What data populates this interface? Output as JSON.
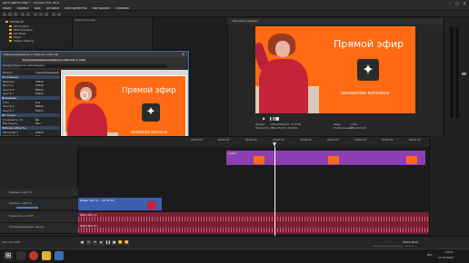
{
  "window": {
    "title": "ДЛЯ ДВНЯ.veg * - VEGAS Pro 16.0",
    "colors": {
      "accent": "#3c6db0",
      "preview_bg": "#ff6a12",
      "clip_purple": "#8b3fb0",
      "audio_red": "#7a1f34",
      "video_blue": "#3c5fb0"
    }
  },
  "menu": [
    "Файл",
    "Правка",
    "Вид",
    "Вставка",
    "Инструменты",
    "Настройки",
    "Справка"
  ],
  "explorer": {
    "items": [
      "NEWBLUE",
      "3D Projects",
      "BMP Publisher",
      "AVI Posts",
      "Music",
      "Master Making"
    ],
    "header": "Транспортные"
  },
  "preview": {
    "header": "Просмотр (видео)",
    "overlay_title": "Прямой эфир",
    "overlay_name": "Nadezhda Koroleva",
    "info": {
      "project_label": "Проект:",
      "project_value": "1920x1080x32, 29,970р",
      "preview_label": "Просмотр:",
      "preview_value": "480x270x32, 29,970р",
      "display_label": "Отображение:",
      "display_value": "385x217x32",
      "frame_label": "Кадр:",
      "frame_value": "1 466"
    }
  },
  "fx_window": {
    "title": "Панорамирование и обрезка событий",
    "tab": "Панорамирование/обрезка событий: 1.mp4",
    "preset_label": "Предустановка:",
    "preset_value": "(по умолчанию)",
    "mode_label": "Режим",
    "mode_value": "Трансформация",
    "sections": [
      {
        "header": "Положение",
        "rows": [
          [
            "Ширина",
            "720,0"
          ],
          [
            "Высота",
            "405,0"
          ],
          [
            "Центр X",
            "960,0"
          ],
          [
            "Центр Y",
            "540,0"
          ]
        ]
      },
      {
        "header": "Вращение",
        "rows": [
          [
            "Угол",
            "0,0"
          ],
          [
            "Центр X",
            "960,0"
          ],
          [
            "Центр Y",
            "540,0"
          ]
        ]
      },
      {
        "header": "Источник",
        "rows": [
          [
            "Сохранить пр.",
            "Да"
          ],
          [
            "Растянуть",
            "Нет"
          ]
        ]
      },
      {
        "header": "Рабочая область",
        "rows": [
          [
            "Масштаб X",
            "100,0"
          ],
          [
            "Сдвиг по X",
            "0,0"
          ],
          [
            "Сдвиг по Y",
            "0,0"
          ]
        ]
      }
    ],
    "overlay_title": "Прямой эфир",
    "overlay_name": "Nadezhda Korolova",
    "position_label": "Положение",
    "mask_label": "Маска",
    "time": "00:00:00;00"
  },
  "timeline": {
    "ruler": [
      "00:00:00",
      "00:00:05",
      "00:00:10",
      "00:00:15",
      "00:00:20",
      "00:00:25",
      "00:00:30",
      "00:00:35",
      "00:00:40"
    ],
    "cursor_time": "00:00:48;26",
    "tracks": [
      {
        "label": "Уровень: 100,0 %",
        "type": "video"
      },
      {
        "label": "Уровень: 100,0 %",
        "type": "video"
      },
      {
        "label": "Громкость: 0,0 dB",
        "type": "audio"
      },
      {
        "label": "Панорамирование: Центр",
        "type": "audio"
      }
    ],
    "clips": [
      {
        "name": "1.mp4",
        "track": 0
      },
      {
        "name": "Видео 001 (1) — 16-35 PC",
        "track": 1
      },
      {
        "name": "Файл 001 (1)",
        "track": 2
      },
      {
        "name": "Файл 001 (1)",
        "track": 3
      }
    ],
    "zoom_label": "Частота: 0,00",
    "record_time": "Время записи (2 канала): 13:02:00"
  },
  "transport": {
    "time": "00:00:48;26",
    "duration": "00:00:00;00"
  },
  "taskbar": {
    "time": "14:57",
    "date": "17.07.2021",
    "lang": "РУС"
  }
}
